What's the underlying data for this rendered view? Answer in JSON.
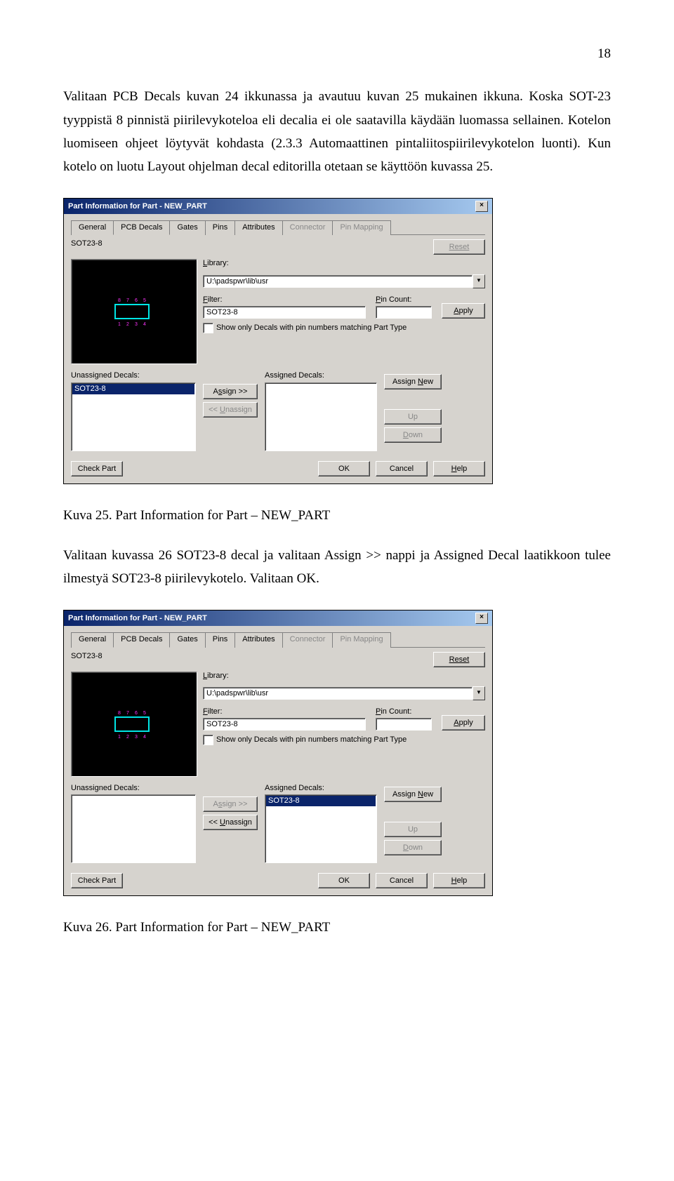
{
  "page_number": "18",
  "para1": "Valitaan PCB Decals kuvan 24 ikkunassa ja avautuu kuvan 25 mukainen ikkuna. Koska SOT-23 tyyppistä 8 pinnistä piirilevykoteloa eli decalia ei ole saatavilla käydään luomassa sellainen. Kotelon luomiseen ohjeet löytyvät kohdasta (2.3.3 Automaattinen pintaliitospiirilevykotelon luonti). Kun kotelo on luotu Layout ohjelman decal editorilla otetaan se käyttöön kuvassa 25.",
  "caption1": "Kuva 25. Part Information for Part – NEW_PART",
  "para2": "Valitaan kuvassa 26 SOT23-8 decal ja valitaan Assign >> nappi ja Assigned Decal laatikkoon tulee ilmestyä SOT23-8 piirilevykotelo. Valitaan OK.",
  "caption2": "Kuva 26. Part Information for Part – NEW_PART",
  "dlg": {
    "title": "Part Information for Part - NEW_PART",
    "tabs": [
      "General",
      "PCB Decals",
      "Gates",
      "Pins",
      "Attributes",
      "Connector",
      "Pin Mapping"
    ],
    "partname": "SOT23-8",
    "reset": "Reset",
    "library_label": "Library:",
    "library_value": "U:\\padspwr\\lib\\usr",
    "filter_label": "Filter:",
    "filter_value": "SOT23-8",
    "pincount_label": "Pin Count:",
    "pincount_value": "",
    "apply": "Apply",
    "checkbox_label": "Show only Decals with pin numbers matching Part Type",
    "unassigned_label": "Unassigned Decals:",
    "assigned_label": "Assigned Decals:",
    "item": "SOT23-8",
    "assign": "Assign >>",
    "unassign": "<< Unassign",
    "assign_new": "Assign New",
    "up": "Up",
    "down": "Down",
    "check": "Check Part",
    "ok": "OK",
    "cancel": "Cancel",
    "help": "Help"
  }
}
